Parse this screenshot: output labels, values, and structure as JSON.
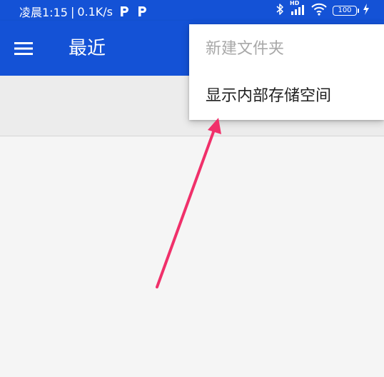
{
  "status_bar": {
    "time": "凌晨1:15",
    "separator": "|",
    "network_speed": "0.1K/s",
    "left_icons": [
      "p-icon",
      "p-icon"
    ],
    "right_icons": [
      "bluetooth-icon",
      "hd-signal-icon",
      "wifi-icon"
    ],
    "hd_label": "HD",
    "battery_level": "100",
    "charging_icon": "charging-bolt-icon"
  },
  "toolbar": {
    "menu_icon": "hamburger-menu-icon",
    "title": "最近"
  },
  "overflow_menu": {
    "items": [
      {
        "label": "新建文件夹",
        "enabled": false
      },
      {
        "label": "显示内部存储空间",
        "enabled": true
      }
    ]
  },
  "annotation": {
    "type": "arrow",
    "color": "#f0306a"
  },
  "colors": {
    "primary": "#1452d6",
    "background": "#f5f5f5",
    "subbar": "#ececec",
    "menu_disabled_text": "#a8a8a8",
    "menu_text": "#202020"
  }
}
